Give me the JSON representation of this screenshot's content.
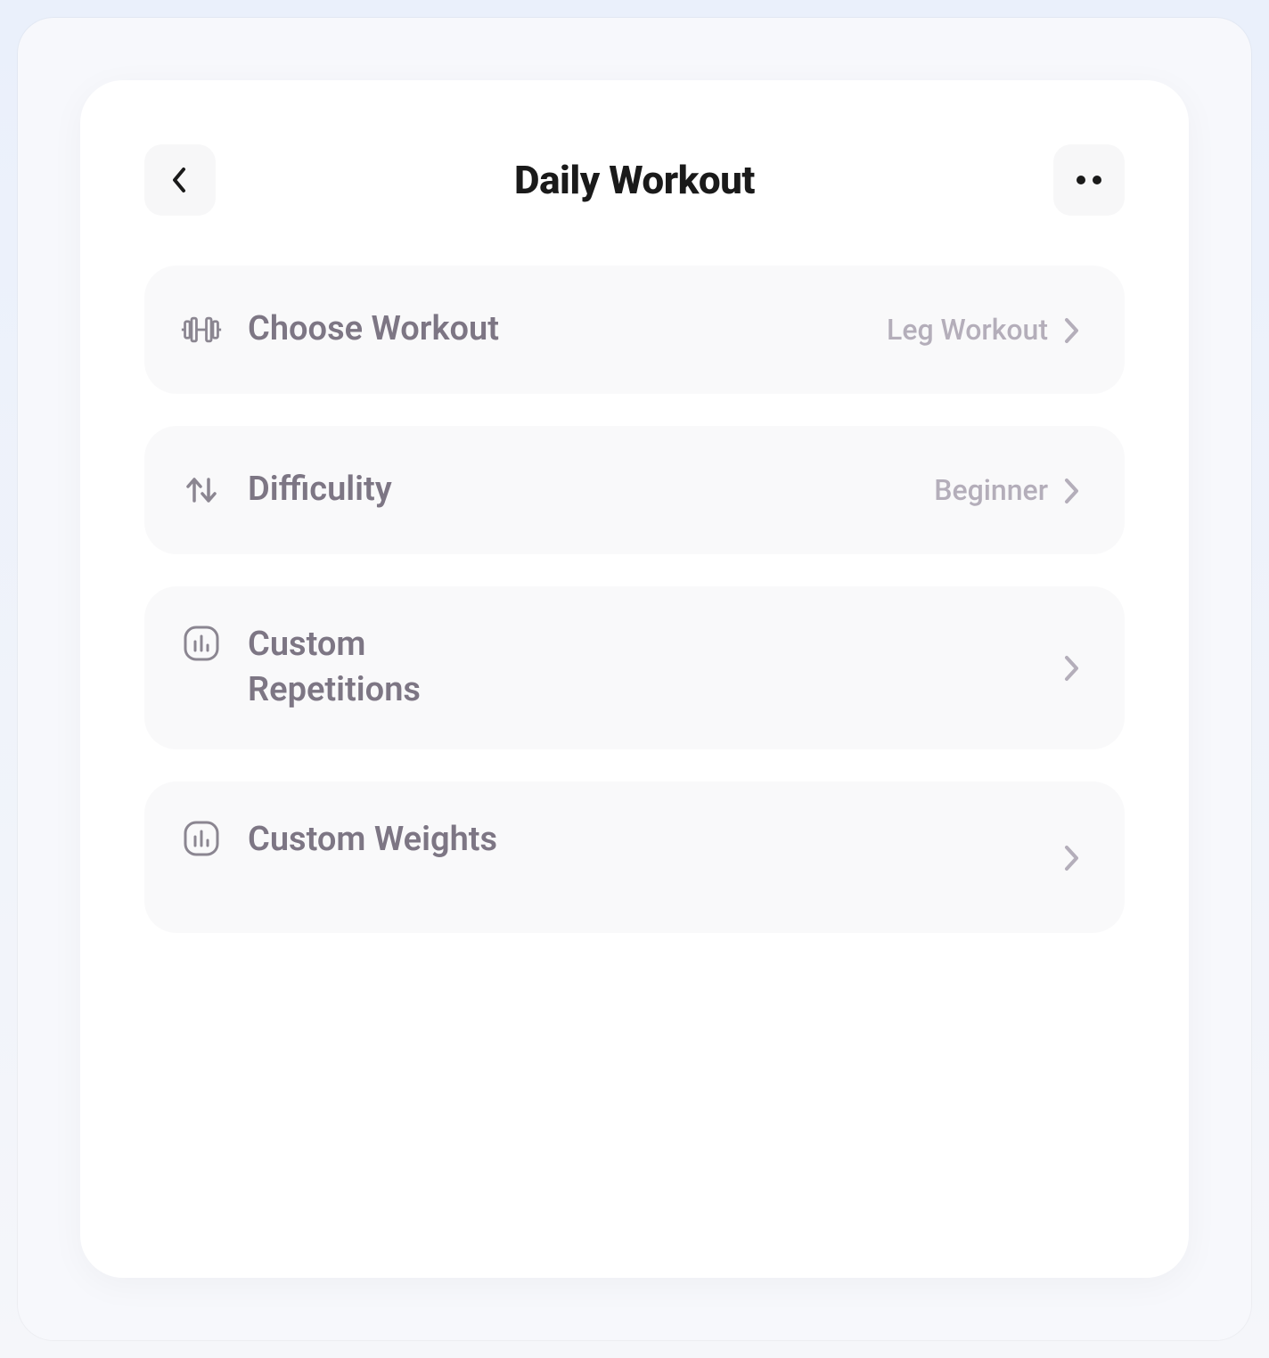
{
  "header": {
    "title": "Daily Workout"
  },
  "rows": [
    {
      "icon": "dumbbell",
      "label": "Choose Workout",
      "value": "Leg Workout"
    },
    {
      "icon": "arrows-up-down",
      "label": "Difficulity",
      "value": "Beginner"
    },
    {
      "icon": "chart-squircle",
      "label": "Custom Repetitions",
      "value": ""
    },
    {
      "icon": "chart-squircle",
      "label": "Custom Weights",
      "value": ""
    }
  ]
}
